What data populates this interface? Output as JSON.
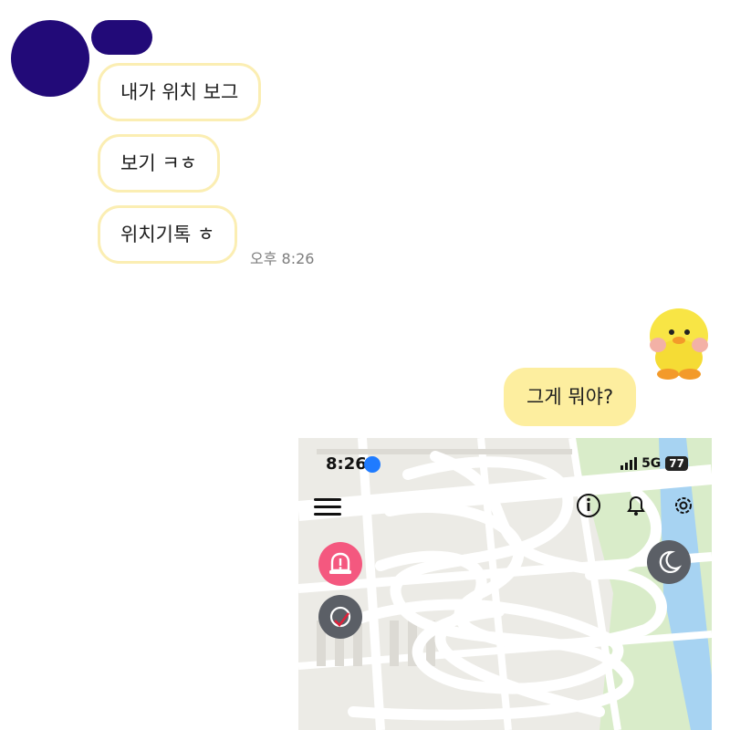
{
  "chat": {
    "received": [
      {
        "text": "내가 위치 보그"
      },
      {
        "text": "보기 ㅋㅎ"
      },
      {
        "text": "위치기톡 ㅎ"
      }
    ],
    "received_time": "오후 8:26",
    "sent": [
      {
        "text": "그게 뭐야?"
      }
    ],
    "sticker": "yellow-duck-plush-sticker"
  },
  "screenshot": {
    "status_time": "8:26",
    "network": "5G",
    "battery": "77",
    "icons": [
      "menu-icon",
      "info-icon",
      "bell-icon",
      "gear-icon",
      "alert-icon",
      "moon-icon",
      "location-icon"
    ],
    "colors": {
      "alert_button": "#f4587f",
      "dark_button": "#5b5f66",
      "river": "#a7d3f2",
      "park": "#d9ecc9"
    }
  }
}
